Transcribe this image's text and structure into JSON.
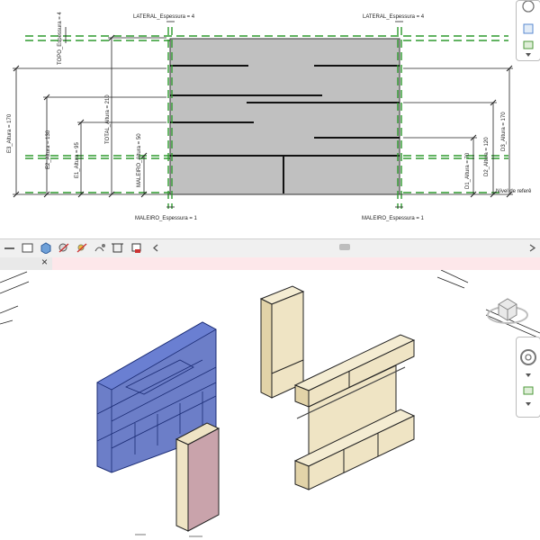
{
  "elevation": {
    "labels": {
      "lateral_left": "LATERAL_Espessura = 4",
      "lateral_right": "LATERAL_Espessura = 4",
      "topo": "TOPO_Espessura = 4",
      "total": "TOTAL_Altura = 210",
      "e3": "E3_Altura = 170",
      "e2": "E2_Altura = 130",
      "e1": "E1_Altura = 95",
      "maleiro_altura": "MALEIRO_Altura = 50",
      "d3": "D3_Altura = 170",
      "d2": "D2_Altura = 120",
      "d1": "D1_Altura = 70",
      "maleiro_left": "MALEIRO_Espessura = 1",
      "maleiro_right": "MALEIRO_Espessura = 1",
      "level": "Nível de referê"
    }
  },
  "colors": {
    "panel_fill": "#c0c0c0",
    "guide_green": "#2e9a2e",
    "wood": "#efe4c4",
    "blue_ghost": "#3b53b6",
    "pink": "#c9a3ab"
  },
  "toolbar": {
    "icons": [
      "scale-icon",
      "model-graphics-icon",
      "visual-style-icon",
      "shadows-icon",
      "sun-path-icon",
      "crop-icon",
      "show-crop-icon",
      "hide-icon"
    ]
  },
  "tabs": {
    "close_glyph": "×"
  }
}
